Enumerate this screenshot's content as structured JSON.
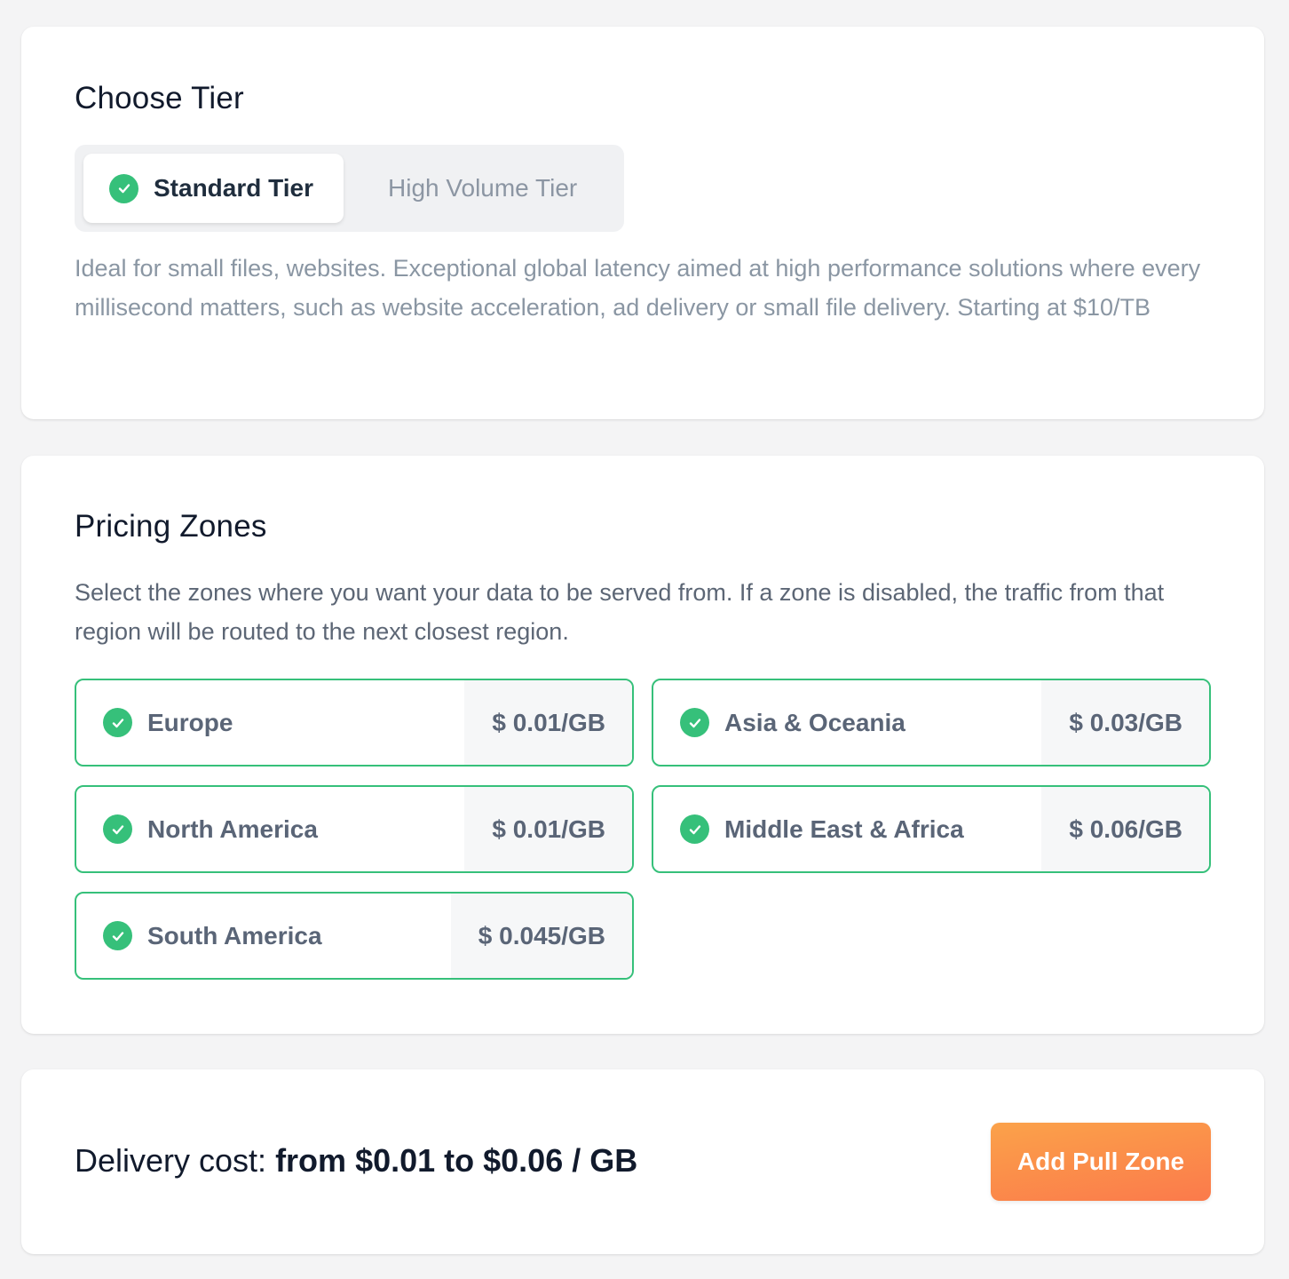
{
  "tier_card": {
    "title": "Choose Tier",
    "options": [
      {
        "label": "Standard Tier",
        "selected": true,
        "icon": "check-circle-icon"
      },
      {
        "label": "High Volume Tier",
        "selected": false
      }
    ],
    "description": "Ideal for small files, websites. Exceptional global latency aimed at high performance solutions where every millisecond matters, such as website acceleration, ad delivery or small file delivery. Starting at $10/TB"
  },
  "zones_card": {
    "title": "Pricing Zones",
    "description": "Select the zones where you want your data to be served from. If a zone is disabled, the traffic from that region will be routed to the next closest region.",
    "zones": [
      {
        "name": "Europe",
        "price": "$ 0.01/GB",
        "enabled": true
      },
      {
        "name": "Asia & Oceania",
        "price": "$ 0.03/GB",
        "enabled": true
      },
      {
        "name": "North America",
        "price": "$ 0.01/GB",
        "enabled": true
      },
      {
        "name": "Middle East & Africa",
        "price": "$ 0.06/GB",
        "enabled": true
      },
      {
        "name": "South America",
        "price": "$ 0.045/GB",
        "enabled": true
      }
    ]
  },
  "footer": {
    "cost_label": "Delivery cost: ",
    "cost_value": "from $0.01 to $0.06 / GB",
    "add_button": "Add Pull Zone"
  },
  "colors": {
    "accent_green": "#36c07a",
    "button_gradient_start": "#fba24a",
    "button_gradient_end": "#fb7a4b"
  }
}
